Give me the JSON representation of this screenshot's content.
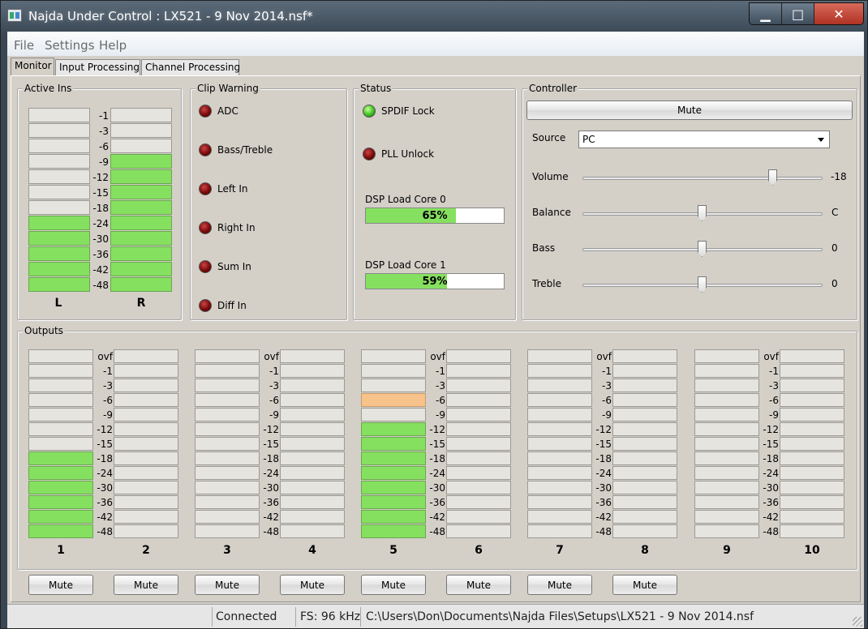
{
  "window": {
    "title": "Najda Under Control : LX521 - 9 Nov 2014.nsf*"
  },
  "menu": [
    "File",
    "Settings",
    "Help"
  ],
  "tabs": [
    "Monitor",
    "Input Processing",
    "Channel Processing"
  ],
  "active_ins": {
    "title": "Active Ins",
    "levels": [
      "-1",
      "-3",
      "-6",
      "-9",
      "-12",
      "-15",
      "-18",
      "-24",
      "-30",
      "-36",
      "-42",
      "-48"
    ],
    "left_label": "L",
    "right_label": "R",
    "left_lit_from": 7,
    "right_lit_from": 3
  },
  "clip_warning": {
    "title": "Clip Warning",
    "items": [
      "ADC",
      "Bass/Treble",
      "Left In",
      "Right In",
      "Sum In",
      "Diff In"
    ]
  },
  "status": {
    "title": "Status",
    "spdif": "SPDIF Lock",
    "pll": "PLL Unlock",
    "core0_label": "DSP Load Core 0",
    "core0_text": "65%",
    "core0_value": 0.65,
    "core1_label": "DSP Load Core 1",
    "core1_text": "59%",
    "core1_value": 0.59
  },
  "controller": {
    "title": "Controller",
    "mute": "Mute",
    "source_label": "Source",
    "source_value": "PC",
    "volume_label": "Volume",
    "volume_value": "-18",
    "balance_label": "Balance",
    "balance_value": "C",
    "bass_label": "Bass",
    "bass_value": "0",
    "treble_label": "Treble",
    "treble_value": "0"
  },
  "outputs": {
    "title": "Outputs",
    "levels": [
      "ovf",
      "-1",
      "-3",
      "-6",
      "-9",
      "-12",
      "-15",
      "-18",
      "-24",
      "-30",
      "-36",
      "-42",
      "-48"
    ],
    "channels": [
      "1",
      "2",
      "3",
      "4",
      "5",
      "6",
      "7",
      "8",
      "9",
      "10"
    ],
    "mute_label": "Mute"
  },
  "statusbar": {
    "connection": "Connected",
    "fs": "FS: 96 kHz",
    "path": "C:\\Users\\Don\\Documents\\Najda Files\\Setups\\LX521 - 9 Nov 2014.nsf"
  },
  "colors": {
    "meter_green": "#86e060",
    "meter_orange": "#f7c38b",
    "meter_off": "#e6e4df"
  }
}
